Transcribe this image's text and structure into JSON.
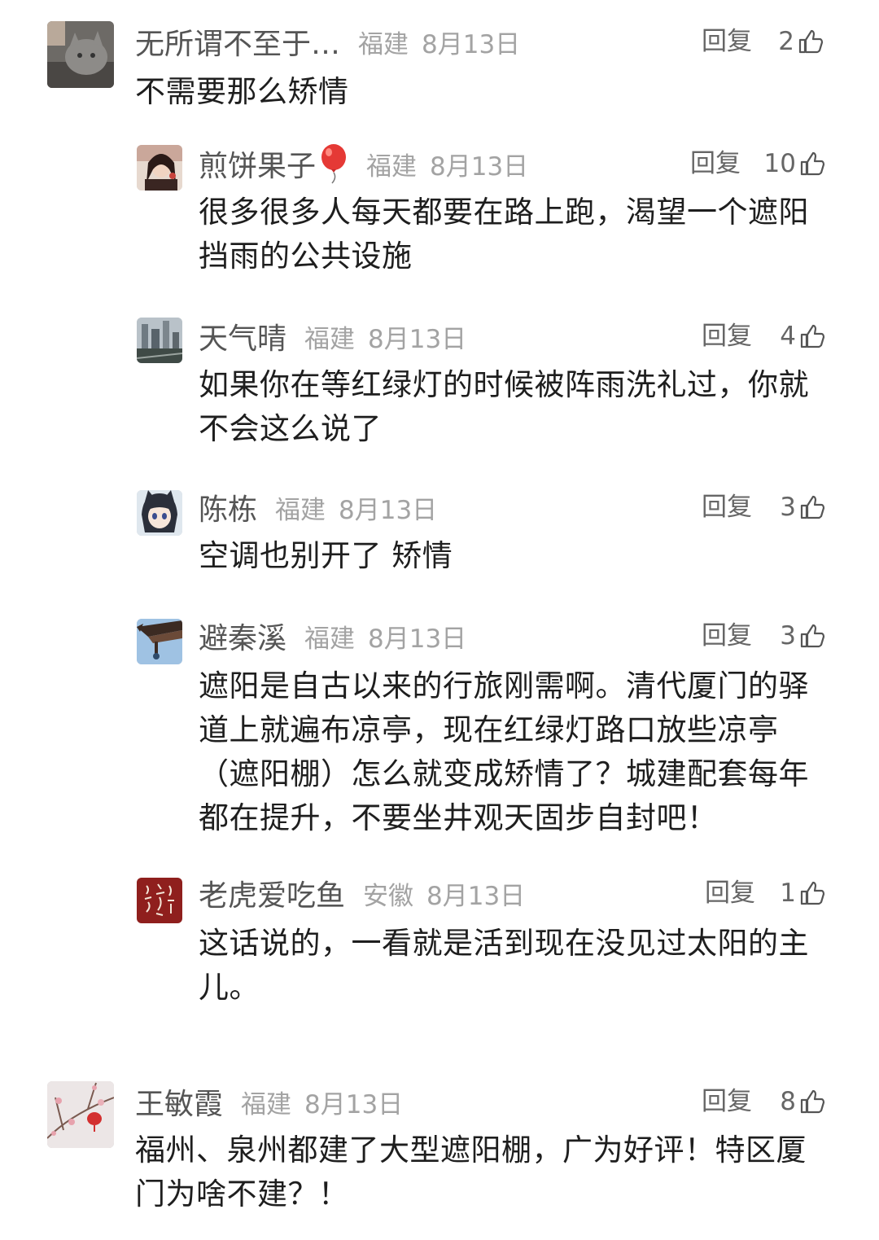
{
  "comments": [
    {
      "user": "无所谓不至于…",
      "location": "福建",
      "date": "8月13日",
      "reply_label": "回复",
      "likes": "2",
      "text": "不需要那么矫情",
      "avatar_icon": "cat-avatar-icon"
    },
    {
      "user": "煎饼果子",
      "location": "福建",
      "date": "8月13日",
      "reply_label": "回复",
      "likes": "10",
      "text_lines": [
        "很多很多人每天都要在路上跑，渴望一个遮阳",
        "挡雨的公共设施"
      ],
      "avatar_icon": "portrait-avatar-icon",
      "name_emoji": "balloon-icon"
    },
    {
      "user": "天气晴",
      "location": "福建",
      "date": "8月13日",
      "reply_label": "回复",
      "likes": "4",
      "text_lines": [
        "如果你在等红绿灯的时候被阵雨洗礼过，你就",
        "不会这么说了"
      ],
      "avatar_icon": "city-avatar-icon"
    },
    {
      "user": "陈栋",
      "location": "福建",
      "date": "8月13日",
      "reply_label": "回复",
      "likes": "3",
      "text": "空调也别开了 矫情",
      "avatar_icon": "anime-avatar-icon"
    },
    {
      "user": "避秦溪",
      "location": "福建",
      "date": "8月13日",
      "reply_label": "回复",
      "likes": "3",
      "text_lines": [
        "遮阳是自古以来的行旅刚需啊。清代厦门的驿",
        "道上就遍布凉亭，现在红绿灯路口放些凉亭",
        "（遮阳棚）怎么就变成矫情了？城建配套每年",
        "都在提升，不要坐井观天固步自封吧！"
      ],
      "avatar_icon": "pavilion-avatar-icon"
    },
    {
      "user": "老虎爱吃鱼",
      "location": "安徽",
      "date": "8月13日",
      "reply_label": "回复",
      "likes": "1",
      "text_lines": [
        "这话说的，一看就是活到现在没见过太阳的主",
        "儿。"
      ],
      "avatar_icon": "calligraphy-avatar-icon"
    },
    {
      "user": "王敏霞",
      "location": "福建",
      "date": "8月13日",
      "reply_label": "回复",
      "likes": "8",
      "text_lines": [
        "福州、泉州都建了大型遮阳棚，广为好评！特区厦",
        "门为啥不建？！"
      ],
      "avatar_icon": "blossom-avatar-icon"
    }
  ]
}
